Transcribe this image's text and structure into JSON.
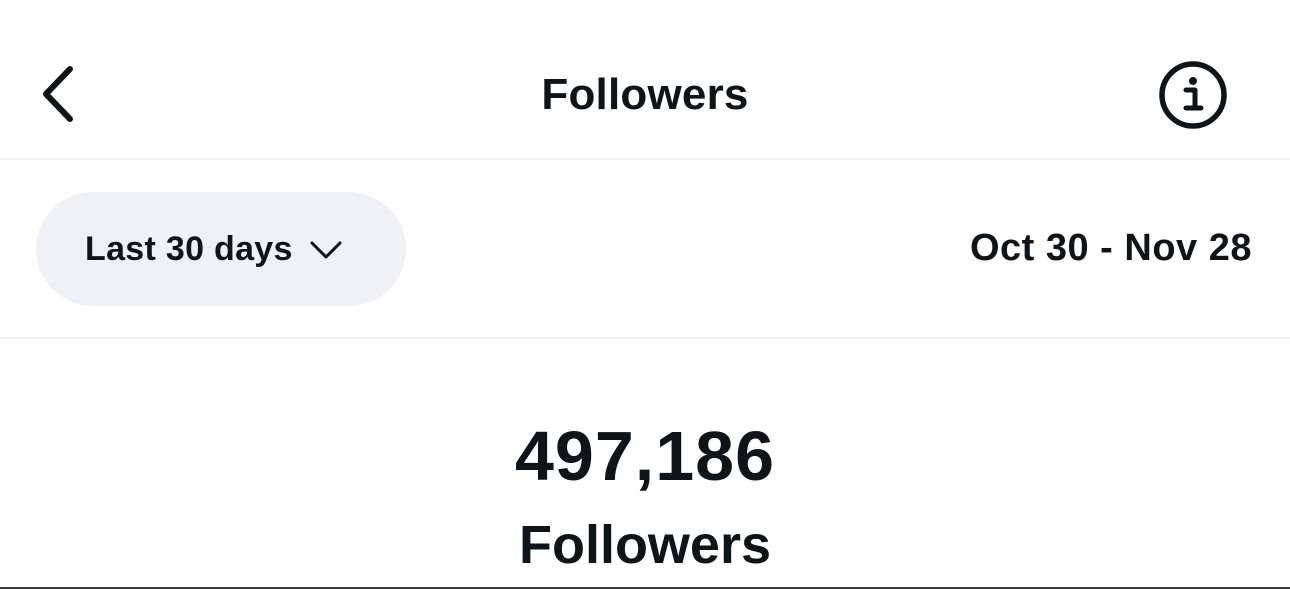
{
  "header": {
    "title": "Followers",
    "back_icon": "chevron-left-icon",
    "info_icon": "info-icon"
  },
  "filter": {
    "range_label": "Last 30 days",
    "range_icon": "chevron-down-icon",
    "date_range": "Oct 30 - Nov 28"
  },
  "stat": {
    "value": "497,186",
    "label": "Followers"
  },
  "colors": {
    "text": "#0f1419",
    "pill_bg": "#eff1f4",
    "divider": "#f2f3f5",
    "background": "#ffffff"
  }
}
